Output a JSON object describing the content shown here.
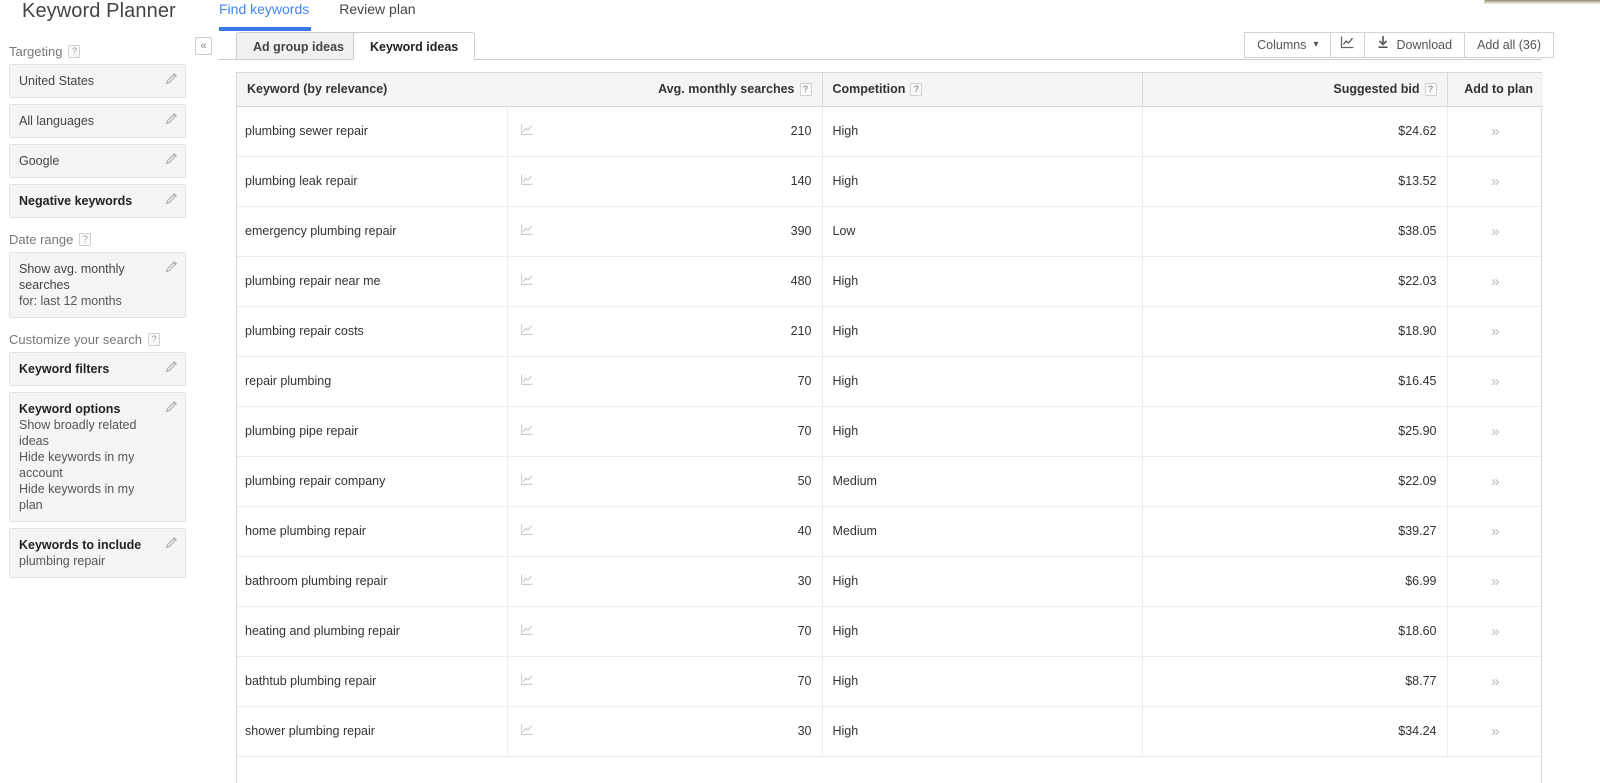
{
  "app": {
    "title": "Keyword Planner"
  },
  "topnav": [
    {
      "label": "Find keywords",
      "active": true
    },
    {
      "label": "Review plan",
      "active": false
    }
  ],
  "sidebar": {
    "collapse_label": "«",
    "groups": [
      {
        "heading": "Targeting",
        "help": "?",
        "cards": [
          {
            "title": "United States",
            "sub": "",
            "bold": false
          },
          {
            "title": "All languages",
            "sub": "",
            "bold": false
          },
          {
            "title": "Google",
            "sub": "",
            "bold": false
          },
          {
            "title": "Negative keywords",
            "sub": "",
            "bold": true
          }
        ]
      },
      {
        "heading": "Date range",
        "help": "?",
        "cards": [
          {
            "title": "Show avg. monthly searches",
            "sub": "for: last 12 months",
            "bold": false
          }
        ]
      },
      {
        "heading": "Customize your search",
        "help": "?",
        "cards": [
          {
            "title": "Keyword filters",
            "sub": "",
            "bold": true
          },
          {
            "title": "Keyword options",
            "sub": "Show broadly related ideas\nHide keywords in my account\nHide keywords in my plan",
            "bold": true
          },
          {
            "title": "Keywords to include",
            "sub": "plumbing repair",
            "bold": true
          }
        ]
      }
    ]
  },
  "tabs": [
    {
      "label": "Ad group ideas",
      "active": false
    },
    {
      "label": "Keyword ideas",
      "active": true
    }
  ],
  "toolbar": {
    "columns_label": "Columns",
    "columns_caret": "▾",
    "chart_icon": "line-chart-icon",
    "download_label": "Download",
    "download_icon": "⬇",
    "add_all_label": "Add all (36)"
  },
  "table": {
    "columns": [
      {
        "key": "keyword",
        "label": "Keyword (by relevance)",
        "help": ""
      },
      {
        "key": "trend",
        "label": "",
        "help": ""
      },
      {
        "key": "volume",
        "label": "Avg. monthly searches",
        "help": "?"
      },
      {
        "key": "competition",
        "label": "Competition",
        "help": "?"
      },
      {
        "key": "bid",
        "label": "Suggested bid",
        "help": "?"
      },
      {
        "key": "plan",
        "label": "Add to plan",
        "help": ""
      }
    ],
    "row_action_icon": "»",
    "rows": [
      {
        "keyword": "plumbing sewer repair",
        "volume": "210",
        "competition": "High",
        "bid": "$24.62"
      },
      {
        "keyword": "plumbing leak repair",
        "volume": "140",
        "competition": "High",
        "bid": "$13.52"
      },
      {
        "keyword": "emergency plumbing repair",
        "volume": "390",
        "competition": "Low",
        "bid": "$38.05"
      },
      {
        "keyword": "plumbing repair near me",
        "volume": "480",
        "competition": "High",
        "bid": "$22.03"
      },
      {
        "keyword": "plumbing repair costs",
        "volume": "210",
        "competition": "High",
        "bid": "$18.90"
      },
      {
        "keyword": "repair plumbing",
        "volume": "70",
        "competition": "High",
        "bid": "$16.45"
      },
      {
        "keyword": "plumbing pipe repair",
        "volume": "70",
        "competition": "High",
        "bid": "$25.90"
      },
      {
        "keyword": "plumbing repair company",
        "volume": "50",
        "competition": "Medium",
        "bid": "$22.09"
      },
      {
        "keyword": "home plumbing repair",
        "volume": "40",
        "competition": "Medium",
        "bid": "$39.27"
      },
      {
        "keyword": "bathroom plumbing repair",
        "volume": "30",
        "competition": "High",
        "bid": "$6.99"
      },
      {
        "keyword": "heating and plumbing repair",
        "volume": "70",
        "competition": "High",
        "bid": "$18.60"
      },
      {
        "keyword": "bathtub plumbing repair",
        "volume": "70",
        "competition": "High",
        "bid": "$8.77"
      },
      {
        "keyword": "shower plumbing repair",
        "volume": "30",
        "competition": "High",
        "bid": "$34.24"
      }
    ]
  },
  "colors": {
    "accent": "#4285f4",
    "tab_underline": "#3b78e7",
    "panel_bg": "#f5f5f5",
    "border": "#d9d9d9"
  }
}
